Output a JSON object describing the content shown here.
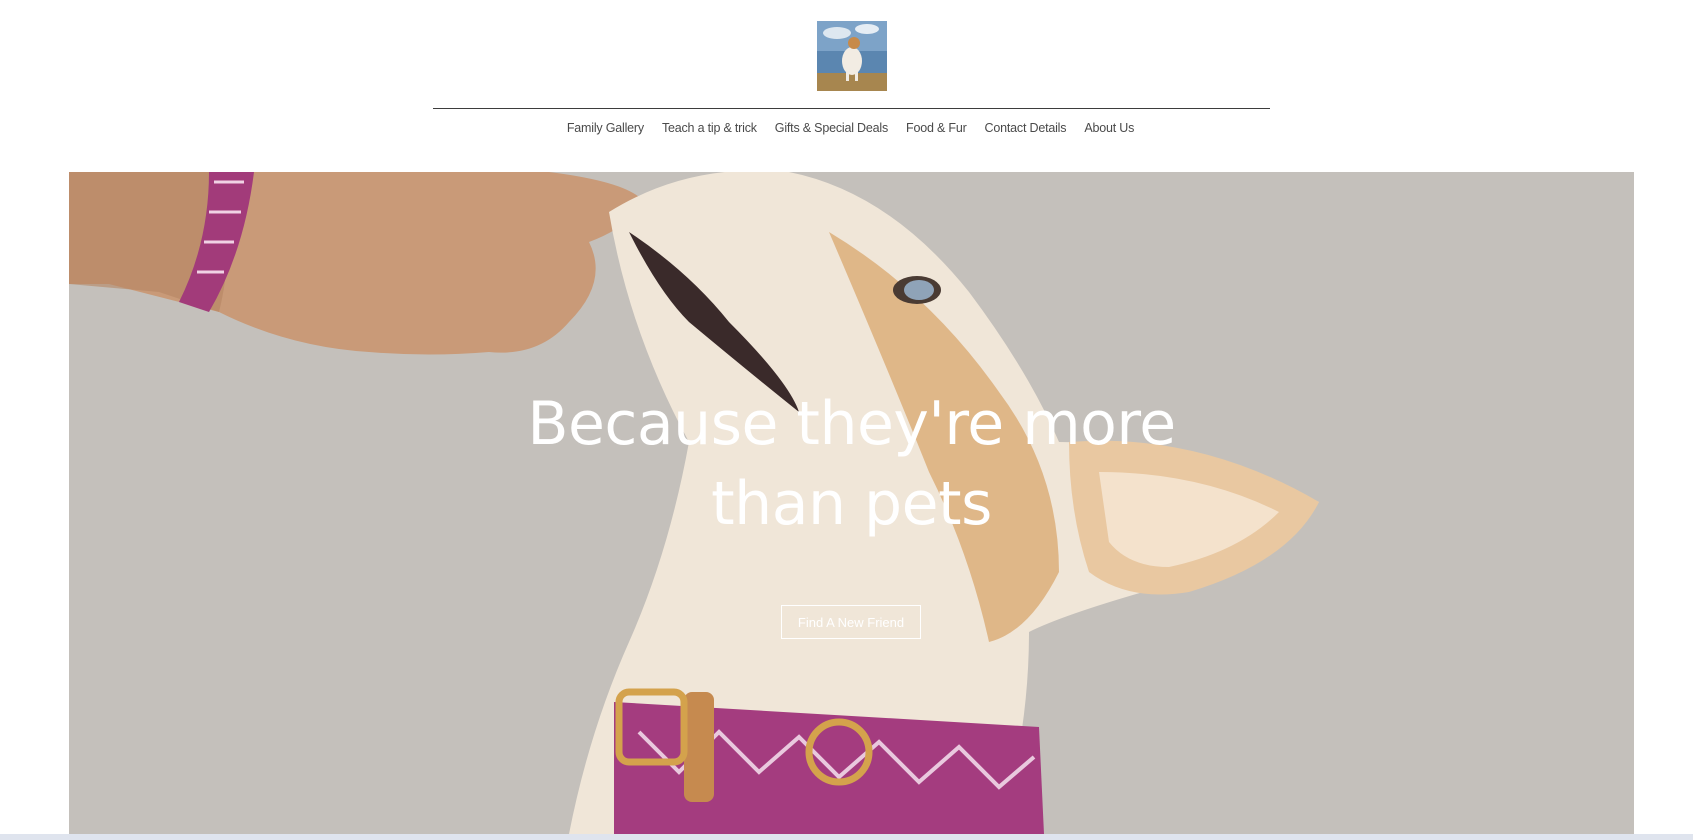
{
  "header": {
    "logo_alt": "dog-photo-logo"
  },
  "nav": {
    "items": [
      {
        "label": "Family Gallery"
      },
      {
        "label": "Teach a tip & trick"
      },
      {
        "label": "Gifts & Special Deals"
      },
      {
        "label": "Food & Fur"
      },
      {
        "label": "Contact Details"
      },
      {
        "label": "About Us"
      }
    ]
  },
  "hero": {
    "headline_line1": "Because they're more",
    "headline_line2": "than pets",
    "cta_label": "Find A New Friend",
    "background_color": "#c4c0bb",
    "text_color": "#ffffff"
  },
  "colors": {
    "divider": "#3d3d3d",
    "nav_text": "#4a4a4a",
    "bottom_strip": "#dfe4ee"
  }
}
